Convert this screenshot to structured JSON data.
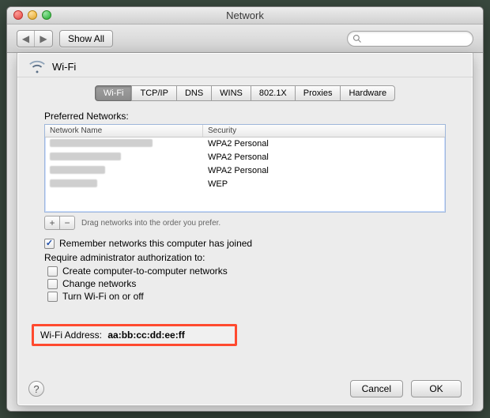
{
  "window": {
    "title": "Network"
  },
  "toolbar": {
    "show_all": "Show All"
  },
  "sheet": {
    "title": "Wi-Fi",
    "tabs": [
      "Wi-Fi",
      "TCP/IP",
      "DNS",
      "WINS",
      "802.1X",
      "Proxies",
      "Hardware"
    ],
    "selected_tab": 0,
    "preferred_label": "Preferred Networks:",
    "columns": {
      "name": "Network Name",
      "security": "Security"
    },
    "rows": [
      {
        "security": "WPA2 Personal"
      },
      {
        "security": "WPA2 Personal"
      },
      {
        "security": "WPA2 Personal"
      },
      {
        "security": "WEP"
      }
    ],
    "drag_hint": "Drag networks into the order you prefer.",
    "remember": {
      "checked": true,
      "label": "Remember networks this computer has joined"
    },
    "require_label": "Require administrator authorization to:",
    "require_opts": [
      {
        "checked": false,
        "label": "Create computer-to-computer networks"
      },
      {
        "checked": false,
        "label": "Change networks"
      },
      {
        "checked": false,
        "label": "Turn Wi-Fi on or off"
      }
    ],
    "mac": {
      "label": "Wi-Fi Address:",
      "value": "aa:bb:cc:dd:ee:ff"
    }
  },
  "buttons": {
    "cancel": "Cancel",
    "ok": "OK"
  }
}
